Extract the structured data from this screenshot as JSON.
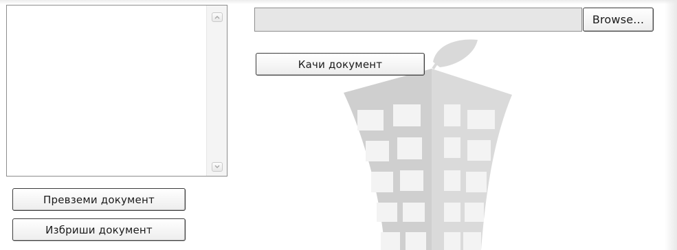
{
  "documents_list": {
    "items": []
  },
  "upload": {
    "file_path": "",
    "browse_label": "Browse...",
    "upload_label": "Качи документ"
  },
  "actions": {
    "download_label": "Превземи документ",
    "delete_label": "Избриши документ"
  },
  "icons": {
    "scroll_up": "chevron-up-icon",
    "scroll_down": "chevron-down-icon",
    "watermark": "building-logo"
  },
  "colors": {
    "watermark": "#d2d2d2",
    "field_bg": "#e6e6e6"
  }
}
